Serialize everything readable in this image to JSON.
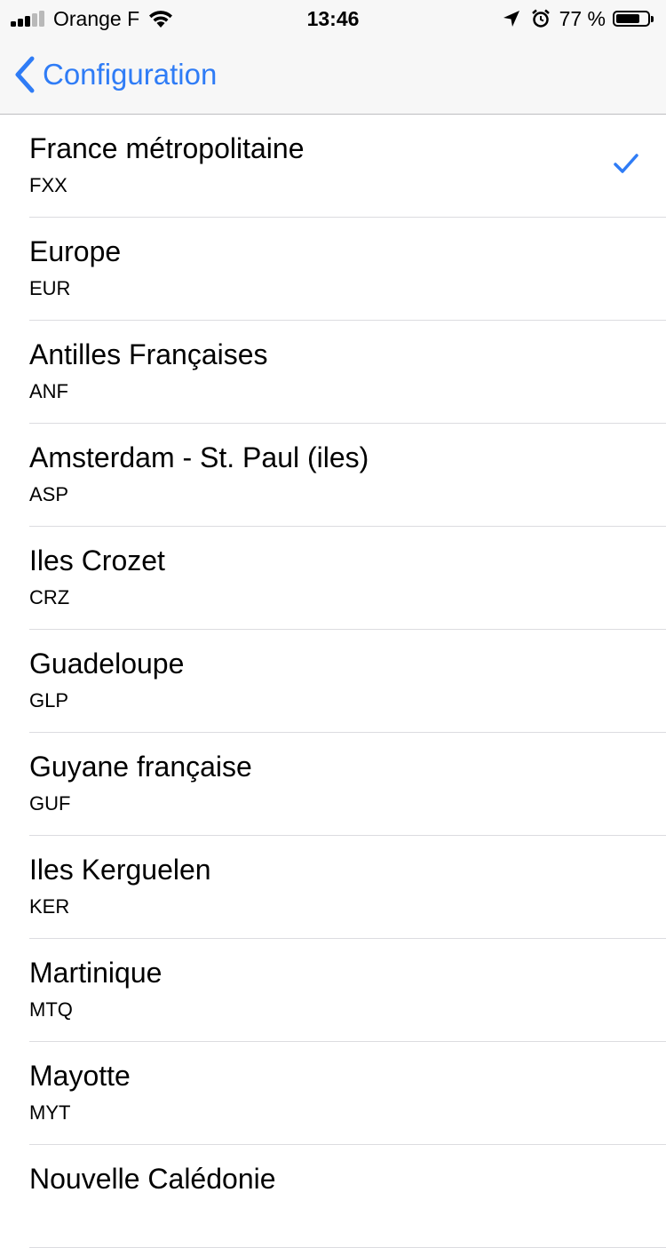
{
  "status_bar": {
    "carrier": "Orange F",
    "time": "13:46",
    "battery_percent": "77 %",
    "battery_level": 0.77,
    "signal_bars_active": 3,
    "signal_bars_total": 5
  },
  "nav_bar": {
    "back_label": "Configuration"
  },
  "colors": {
    "accent": "#2f7cf6"
  },
  "list": {
    "items": [
      {
        "name": "France métropolitaine",
        "code": "FXX",
        "selected": true
      },
      {
        "name": "Europe",
        "code": "EUR",
        "selected": false
      },
      {
        "name": "Antilles Françaises",
        "code": "ANF",
        "selected": false
      },
      {
        "name": "Amsterdam - St. Paul (iles)",
        "code": "ASP",
        "selected": false
      },
      {
        "name": "Iles Crozet",
        "code": "CRZ",
        "selected": false
      },
      {
        "name": "Guadeloupe",
        "code": "GLP",
        "selected": false
      },
      {
        "name": "Guyane française",
        "code": "GUF",
        "selected": false
      },
      {
        "name": "Iles Kerguelen",
        "code": "KER",
        "selected": false
      },
      {
        "name": "Martinique",
        "code": "MTQ",
        "selected": false
      },
      {
        "name": "Mayotte",
        "code": "MYT",
        "selected": false
      },
      {
        "name": "Nouvelle Calédonie",
        "code": "",
        "selected": false
      }
    ]
  }
}
